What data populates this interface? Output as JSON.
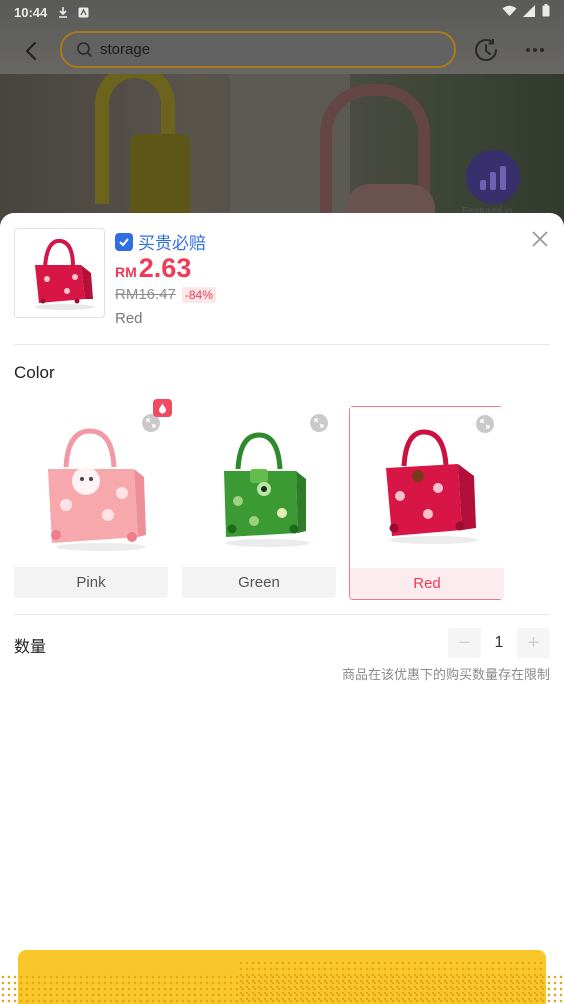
{
  "status_bar": {
    "time": "10:44"
  },
  "search": {
    "query": "storage"
  },
  "featured_label": "Featured in",
  "product": {
    "guarantee_label": "买贵必赔",
    "currency": "RM",
    "price": "2.63",
    "original_price": "RM16.47",
    "discount": "-84%",
    "selected_variant": "Red"
  },
  "color_section": {
    "title": "Color",
    "options": [
      {
        "label": "Pink",
        "hot": true,
        "selected": false,
        "color": "#f7a8ad"
      },
      {
        "label": "Green",
        "hot": false,
        "selected": false,
        "color": "#3c9a35"
      },
      {
        "label": "Red",
        "hot": false,
        "selected": true,
        "color": "#d81646"
      }
    ]
  },
  "quantity": {
    "title": "数量",
    "value": "1",
    "minus": "−",
    "plus": "+",
    "limit_note": "商品在该优惠下的购买数量存在限制"
  },
  "colors": {
    "accent_price": "#ee3b57",
    "guarantee_blue": "#2f6fe4",
    "cta_yellow": "#f9c72a"
  }
}
